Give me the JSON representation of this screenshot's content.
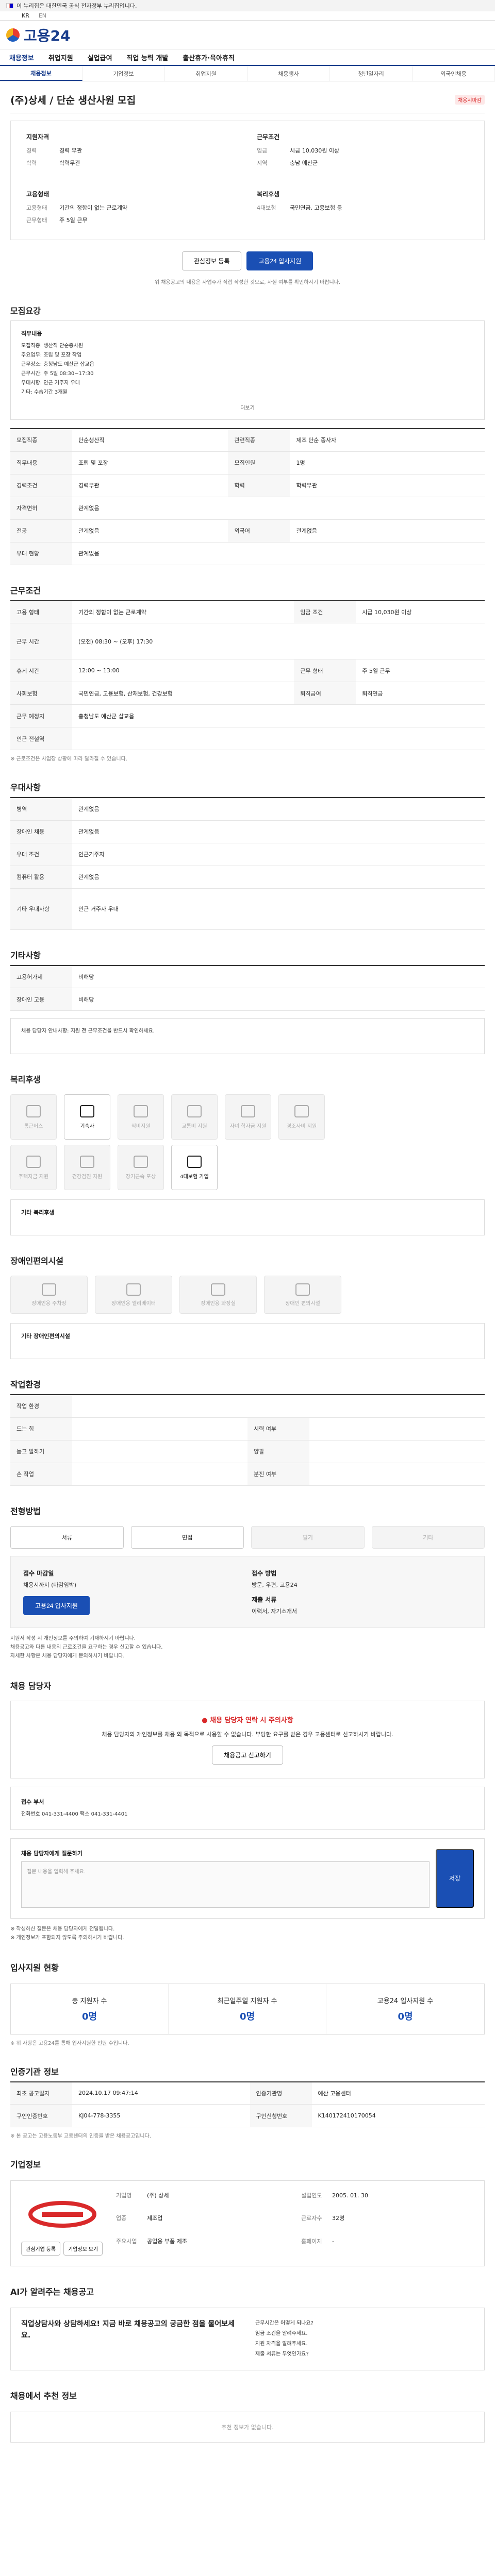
{
  "gov": {
    "notice": "이 누리집은 대한민국 공식 전자정부 누리집입니다."
  },
  "lang": {
    "ko": "KR",
    "en": "EN"
  },
  "site": {
    "name": "고용24"
  },
  "gnb": [
    "채용정보",
    "취업지원",
    "실업급여",
    "직업 능력 개발",
    "출산휴가·육아휴직"
  ],
  "subnav": [
    "채용정보",
    "기업정보",
    "취업지원",
    "채용행사",
    "청년일자리",
    "외국인채용"
  ],
  "job": {
    "title": "(주)상세 / 단순 생산사원 모집",
    "dday": "채용시마감",
    "summary": {
      "qual_title": "지원자격",
      "qual": [
        {
          "k": "경력",
          "v": "경력 무관"
        },
        {
          "k": "학력",
          "v": "학력무관"
        }
      ],
      "cond_title": "근무조건",
      "cond": [
        {
          "k": "임금",
          "v": "시급 10,030원 이상"
        },
        {
          "k": "지역",
          "v": "충남 예산군"
        }
      ],
      "type_title": "고용형태",
      "type": [
        {
          "k": "고용형태",
          "v": "기간의 정함이 없는 근로계약"
        },
        {
          "k": "근무형태",
          "v": "주 5일 근무"
        }
      ],
      "welfare_title": "복리후생",
      "welfare": [
        {
          "k": "4대보험",
          "v": "국민연금, 고용보험 등"
        }
      ]
    },
    "btn_scrap": "관심정보 등록",
    "btn_apply": "고용24 입사지원",
    "apply_notice": "위 채용공고의 내용은 사업주가 직접 작성한 것으로, 사실 여부를 확인하시기 바랍니다."
  },
  "sections": {
    "recruit": "모집요강",
    "work": "근무조건",
    "prefer": "우대사항",
    "etc": "기타사항",
    "welfare": "복리후생",
    "disab": "장애인편의시설",
    "workplace": "작업환경",
    "method": "전형방법",
    "manager": "채용 담당자",
    "stats": "입사지원 현황",
    "info": "인증기관 정보",
    "company": "기업정보",
    "chat": "AI가 알려주는 채용공고",
    "similar": "채용에서 추천 정보"
  },
  "recruit": {
    "box_title": "직무내용",
    "lines": [
      "모집직종: 생산직 단순종사원",
      "주요업무: 조립 및 포장 작업",
      "근무장소: 충청남도 예산군 삽교읍",
      "근무시간: 주 5일 08:30~17:30",
      "우대사항: 인근 거주자 우대",
      "기타: 수습기간 3개월"
    ],
    "more": "더보기",
    "rows": [
      {
        "th": "모집직종",
        "td": "단순생산직",
        "th2": "관련직종",
        "td2": "제조 단순 종사자"
      },
      {
        "th": "직무내용",
        "td": "조립 및 포장",
        "th2": "모집인원",
        "td2": "1명"
      },
      {
        "th": "경력조건",
        "td": "경력무관",
        "th2": "학력",
        "td2": "학력무관"
      },
      {
        "th": "자격면허",
        "td": "관계없음",
        "th2": "",
        "td2": ""
      },
      {
        "th": "전공",
        "td": "관계없음",
        "th2": "외국어",
        "td2": "관계없음"
      },
      {
        "th": "우대 현황",
        "td": "관계없음",
        "th2": "",
        "td2": ""
      }
    ]
  },
  "work": {
    "rows": [
      {
        "th": "고용 형태",
        "td": "기간의 정함이 없는 근로계약",
        "th2": "임금 조건",
        "td2": "시급 10,030원 이상"
      },
      {
        "th": "근무 시간",
        "td": "(오전) 08:30 ~ (오후) 17:30",
        "th2": "",
        "td2": ""
      },
      {
        "th": "휴게 시간",
        "td": "12:00 ~ 13:00",
        "th2": "근무 형태",
        "td2": "주 5일 근무"
      },
      {
        "th": "사회보험",
        "td": "국민연금, 고용보험, 산재보험, 건강보험",
        "th2": "퇴직급여",
        "td2": "퇴직연금"
      },
      {
        "th": "근무 예정지",
        "td": "충청남도 예산군 삽교읍",
        "th2": "",
        "td2": ""
      },
      {
        "th": "인근 전철역",
        "td": "",
        "th2": "",
        "td2": ""
      }
    ],
    "note": "※ 근로조건은 사업장 상황에 따라 달라질 수 있습니다."
  },
  "prefer": {
    "rows": [
      {
        "th": "병역",
        "td": "관계없음"
      },
      {
        "th": "장애인 채용",
        "td": "관계없음"
      },
      {
        "th": "우대 조건",
        "td": "인근거주자"
      },
      {
        "th": "컴퓨터 활용",
        "td": "관계없음"
      },
      {
        "th": "기타 우대사항",
        "td": "인근 거주자 우대"
      }
    ]
  },
  "etc": {
    "rows": [
      {
        "th": "고용허가제",
        "td": "비해당"
      },
      {
        "th": "장애인 고용",
        "td": "비해당"
      }
    ],
    "alert": "채용 담당자 안내사항: 지원 전 근무조건을 반드시 확인하세요."
  },
  "welfare": {
    "cards": [
      "통근버스",
      "기숙사",
      "식비지원",
      "교통비 지원",
      "자녀 학자금 지원",
      "경조사비 지원",
      "주택자금 지원",
      "건강검진 지원",
      "장기근속 포상",
      "4대보험 가입"
    ],
    "active": [
      1,
      9
    ],
    "other_title": "기타 복리후생"
  },
  "disab": {
    "cards": [
      "장애인용 주차장",
      "장애인용 엘리베이터",
      "장애인용 화장실",
      "장애인 편의시설"
    ],
    "other_title": "기타 장애인편의시설"
  },
  "workplace": {
    "rows": [
      {
        "th": "작업 환경",
        "td": "",
        "th2": "",
        "td2": ""
      },
      {
        "th": "드는 힘",
        "td": "",
        "th2": "시력 여부",
        "td2": ""
      },
      {
        "th": "듣고 말하기",
        "td": "",
        "th2": "양팔",
        "td2": ""
      },
      {
        "th": "손 작업",
        "td": "",
        "th2": "분진 여부",
        "td2": ""
      }
    ]
  },
  "method": {
    "items": [
      "서류",
      "면접",
      "필기",
      "기타"
    ],
    "active": [
      0,
      1
    ],
    "deadline_label": "접수 마감일",
    "deadline": "채용시까지 (마감임박)",
    "method_label": "접수 방법",
    "method_val": "방문, 우편, 고용24",
    "doc_label": "제출 서류",
    "doc_val": "이력서, 자기소개서",
    "apply_btn": "고용24 입사지원",
    "bullets": [
      "지원서 작성 시 개인정보를 주의하여 기재하시기 바랍니다.",
      "채용공고와 다른 내용의 근로조건을 요구하는 경우 신고할 수 있습니다.",
      "자세한 사항은 채용 담당자에게 문의하시기 바랍니다."
    ]
  },
  "manager": {
    "warn_title": "채용 담당자 연락 시 주의사항",
    "warn_text": "채용 담당자의 개인정보를 채용 외 목적으로 사용할 수 없습니다. 부당한 요구를 받은 경우 고용센터로 신고하시기 바랍니다.",
    "report_btn": "채용공고 신고하기",
    "contact_title": "접수 부서",
    "contact_line": "전화번호 041-331-4400   팩스 041-331-4401",
    "ask_title": "채용 담당자에게 질문하기",
    "ask_placeholder": "질문 내용을 입력해 주세요.",
    "ask_btn": "저장",
    "notes": [
      "※ 작성하신 질문은 채용 담당자에게 전달됩니다.",
      "※ 개인정보가 포함되지 않도록 주의하시기 바랍니다."
    ]
  },
  "stats": {
    "items": [
      {
        "label": "총 지원자 수",
        "num": "0명"
      },
      {
        "label": "최근일주일 지원자 수",
        "num": "0명"
      },
      {
        "label": "고용24 입사지원 수",
        "num": "0명"
      }
    ],
    "note": "※ 위 사항은 고용24를 통해 입사지원한 인원 수입니다."
  },
  "info": {
    "rows": [
      {
        "th": "최초 공고일자",
        "td": "2024.10.17 09:47:14",
        "th2": "인증기관명",
        "td2": "예산 고용센터"
      },
      {
        "th": "구인인증번호",
        "td": "KJ04-778-3355",
        "th2": "구인신청번호",
        "td2": "K140172410170054"
      }
    ],
    "note": "※ 본 공고는 고용노동부 고용센터의 인증을 받은 채용공고입니다."
  },
  "company": {
    "name": "(주) 상세",
    "info": [
      {
        "k": "기업명",
        "v": "(주) 상세"
      },
      {
        "k": "설립연도",
        "v": "2005. 01. 30"
      },
      {
        "k": "업종",
        "v": "제조업"
      },
      {
        "k": "근로자수",
        "v": "32명"
      },
      {
        "k": "주요사업",
        "v": "공업용 부품 제조"
      },
      {
        "k": "홈페이지",
        "v": "-"
      }
    ],
    "btn1": "관심기업 등록",
    "btn2": "기업정보 보기"
  },
  "chat": {
    "left": "직업상담사와 상담하세요! 지금 바로 채용공고의 궁금한 점을 물어보세요.",
    "items": [
      "근무시간은 어떻게 되나요?",
      "임금 조건을 알려주세요.",
      "지원 자격을 알려주세요.",
      "제출 서류는 무엇인가요?"
    ]
  },
  "similar": {
    "empty": "추천 정보가 없습니다."
  }
}
